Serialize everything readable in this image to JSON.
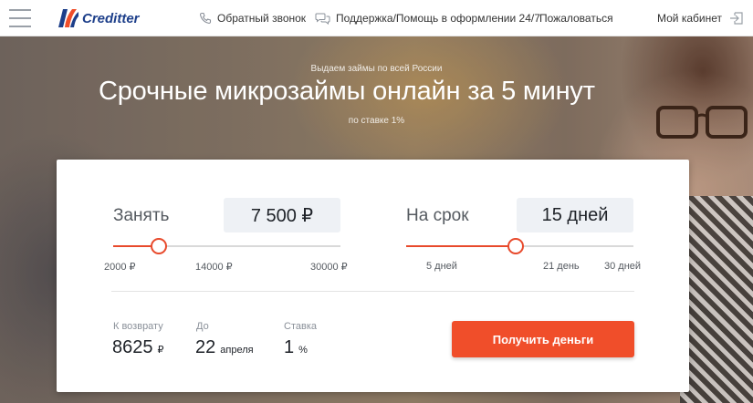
{
  "header": {
    "logo_text": "Creditter",
    "callback_label": "Обратный звонок",
    "support_label": "Поддержка/Помощь в оформлении 24/7",
    "complain_label": "Пожаловаться",
    "cabinet_label": "Мой кабинет"
  },
  "hero": {
    "subtitle": "Выдаем займы по всей России",
    "title": "Срочные микрозаймы онлайн за 5 минут",
    "rate_note": "по ставке 1%"
  },
  "calculator": {
    "amount": {
      "label": "Занять",
      "value": "7 500 ₽",
      "slider_fraction": 0.2,
      "ticks": [
        "2000 ₽",
        "14000 ₽",
        "30000 ₽"
      ]
    },
    "term": {
      "label": "На срок",
      "value": "15 дней",
      "slider_fraction": 0.48,
      "ticks": [
        "5 дней",
        "21 день",
        "30 дней"
      ]
    },
    "summary": {
      "return_label": "К возврату",
      "return_value": "8625",
      "return_unit": "₽",
      "until_label": "До",
      "until_value": "22",
      "until_unit": "апреля",
      "rate_label": "Ставка",
      "rate_value": "1",
      "rate_unit": "%"
    },
    "cta_label": "Получить деньги"
  },
  "colors": {
    "accent": "#f04e2a",
    "brand": "#1d3f8a",
    "input_bg": "#eef1f5"
  },
  "icons": [
    "menu-icon",
    "creditter-logo-icon",
    "phone-icon",
    "chat-icon",
    "login-icon"
  ]
}
